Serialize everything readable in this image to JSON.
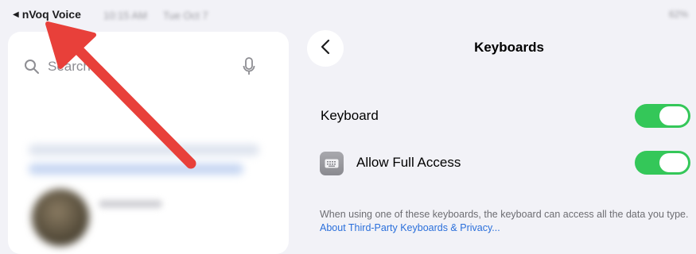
{
  "status_bar": {
    "back_app_label": "nVoq Voice",
    "time_blurred": "10:15 AM",
    "date_blurred": "Tue Oct 7",
    "right_blurred": "62%"
  },
  "sidebar": {
    "search_placeholder": "Search"
  },
  "detail": {
    "title": "Keyboards",
    "rows": [
      {
        "label": "Keyboard",
        "on": true
      },
      {
        "label": "Allow Full Access",
        "on": true
      }
    ],
    "footnote_text": "When using one of these keyboards, the keyboard can access all the data you type. ",
    "footnote_link": "About Third-Party Keyboards & Privacy..."
  },
  "colors": {
    "toggle_on": "#34c759",
    "link": "#2a6fdb",
    "annotation": "#e8403a"
  },
  "icons": [
    "back-triangle-icon",
    "search-icon",
    "microphone-icon",
    "chevron-left-icon",
    "keyboard-icon"
  ]
}
